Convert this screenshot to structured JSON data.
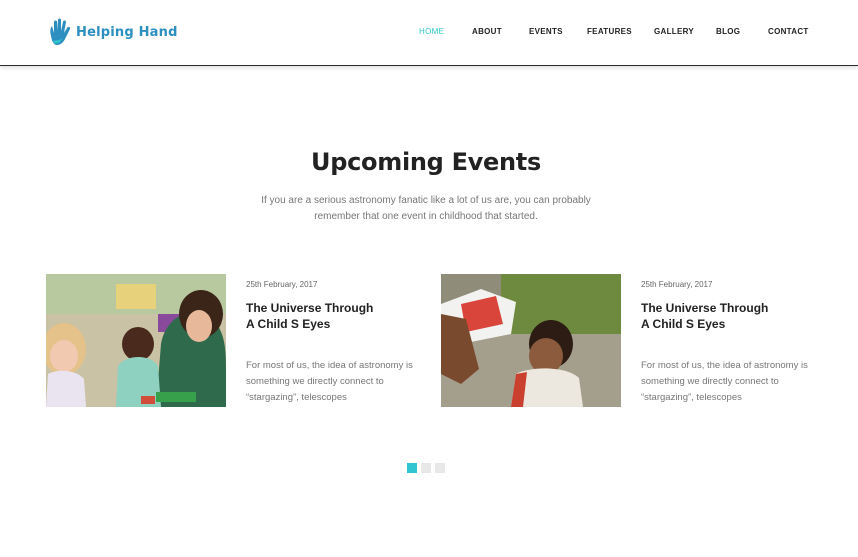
{
  "brand": {
    "name": "Helping Hand",
    "accent": "#30c5d0",
    "logo_color": "#2c8fc0"
  },
  "nav": {
    "items": [
      {
        "label": "HOME",
        "active": true
      },
      {
        "label": "ABOUT"
      },
      {
        "label": "EVENTS"
      },
      {
        "label": "FEATURES"
      },
      {
        "label": "GALLERY"
      },
      {
        "label": "BLOG"
      },
      {
        "label": "CONTACT"
      }
    ]
  },
  "section": {
    "title": "Upcoming Events",
    "description": "If you are a serious astronomy fanatic like a lot of us are, you can probably remember that one event in childhood that started."
  },
  "events": [
    {
      "date": "25th February, 2017",
      "title": "The Universe Through A Child S Eyes",
      "text": "For most of us, the idea of astronomy is something we directly connect to “stargazing”, telescopes"
    },
    {
      "date": "25th February, 2017",
      "title": "The Universe Through A Child S Eyes",
      "text": "For most of us, the idea of astronomy is something we directly connect to “stargazing”, telescopes"
    }
  ],
  "carousel": {
    "pages": 3,
    "active_index": 0
  }
}
